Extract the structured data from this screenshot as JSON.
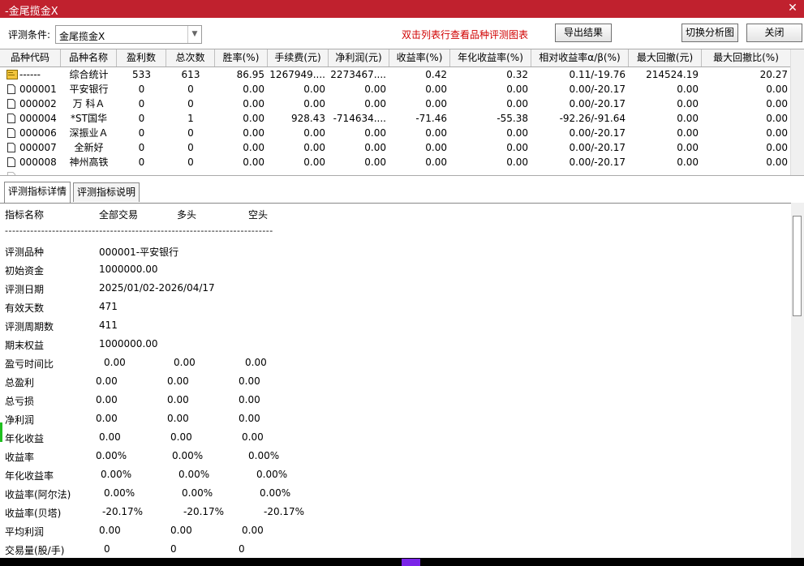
{
  "window": {
    "title": "-金尾揽金X",
    "close_glyph": "✕"
  },
  "toolbar": {
    "label": "评测条件:",
    "combo_value": "金尾揽金X",
    "hint": "双击列表行查看品种评测图表",
    "export_label": "导出结果",
    "switch_label": "切换分析图",
    "close_label": "关闭"
  },
  "table": {
    "columns": [
      "品种代码",
      "品种名称",
      "盈利数",
      "总次数",
      "胜率(%)",
      "手续费(元)",
      "净利润(元)",
      "收益率(%)",
      "年化收益率(%)",
      "相对收益率α/β(%)",
      "最大回撤(元)",
      "最大回撤比(%)"
    ],
    "rows": [
      [
        "------",
        "综合统计",
        "533",
        "613",
        "86.95",
        "1267949....",
        "2273467....",
        "0.42",
        "0.32",
        "0.11/-19.76",
        "214524.19",
        "20.27"
      ],
      [
        "000001",
        "平安银行",
        "0",
        "0",
        "0.00",
        "0.00",
        "0.00",
        "0.00",
        "0.00",
        "0.00/-20.17",
        "0.00",
        "0.00"
      ],
      [
        "000002",
        "万  科Ａ",
        "0",
        "0",
        "0.00",
        "0.00",
        "0.00",
        "0.00",
        "0.00",
        "0.00/-20.17",
        "0.00",
        "0.00"
      ],
      [
        "000004",
        "*ST国华",
        "0",
        "1",
        "0.00",
        "928.43",
        "-714634....",
        "-71.46",
        "-55.38",
        "-92.26/-91.64",
        "0.00",
        "0.00"
      ],
      [
        "000006",
        "深振业Ａ",
        "0",
        "0",
        "0.00",
        "0.00",
        "0.00",
        "0.00",
        "0.00",
        "0.00/-20.17",
        "0.00",
        "0.00"
      ],
      [
        "000007",
        "全新好",
        "0",
        "0",
        "0.00",
        "0.00",
        "0.00",
        "0.00",
        "0.00",
        "0.00/-20.17",
        "0.00",
        "0.00"
      ],
      [
        "000008",
        "神州高铁",
        "0",
        "0",
        "0.00",
        "0.00",
        "0.00",
        "0.00",
        "0.00",
        "0.00/-20.17",
        "0.00",
        "0.00"
      ]
    ]
  },
  "tabs": [
    "评测指标详情",
    "评测指标说明"
  ],
  "detail": {
    "header": {
      "name": "指标名称",
      "all": "全部交易",
      "long": "多头",
      "short": "空头"
    },
    "separator": "--------------------------------------------------------------------------",
    "single": [
      {
        "label": "评测品种",
        "value": "000001-平安银行"
      },
      {
        "label": "初始资金",
        "value": "1000000.00"
      },
      {
        "label": "评测日期",
        "value": "2025/01/02-2026/04/17"
      },
      {
        "label": "有效天数",
        "value": "471"
      },
      {
        "label": "评测周期数",
        "value": " 411"
      },
      {
        "label": "期末权益",
        "value": "1000000.00"
      }
    ],
    "triple": [
      {
        "label": "盈亏时间比",
        "a": "0.00",
        "b": "0.00",
        "c": "0.00"
      },
      {
        "label": "总盈利",
        "a": "0.00",
        "b": "0.00",
        "c": "0.00"
      },
      {
        "label": "总亏损",
        "a": "0.00",
        "b": "0.00",
        "c": "0.00"
      },
      {
        "label": "净利润",
        "a": "0.00",
        "b": "0.00",
        "c": "0.00"
      },
      {
        "label": "年化收益",
        "a": "0.00",
        "b": "0.00",
        "c": "0.00"
      },
      {
        "label": "收益率",
        "a": "0.00%",
        "b": "0.00%",
        "c": "0.00%"
      },
      {
        "label": "年化收益率",
        "a": "0.00%",
        "b": "0.00%",
        "c": "0.00%"
      },
      {
        "label": "收益率(阿尔法)",
        "a": "0.00%",
        "b": "0.00%",
        "c": "0.00%"
      },
      {
        "label": "收益率(贝塔)",
        "a": "-20.17%",
        "b": "-20.17%",
        "c": "-20.17%"
      },
      {
        "label": "平均利润",
        "a": "0.00",
        "b": "0.00",
        "c": "0.00"
      },
      {
        "label": "交易量(股/手)",
        "a": "0",
        "b": "0",
        "c": "0"
      }
    ]
  },
  "colors": {
    "titlebar": "#c0212e",
    "hint": "#d00000"
  }
}
